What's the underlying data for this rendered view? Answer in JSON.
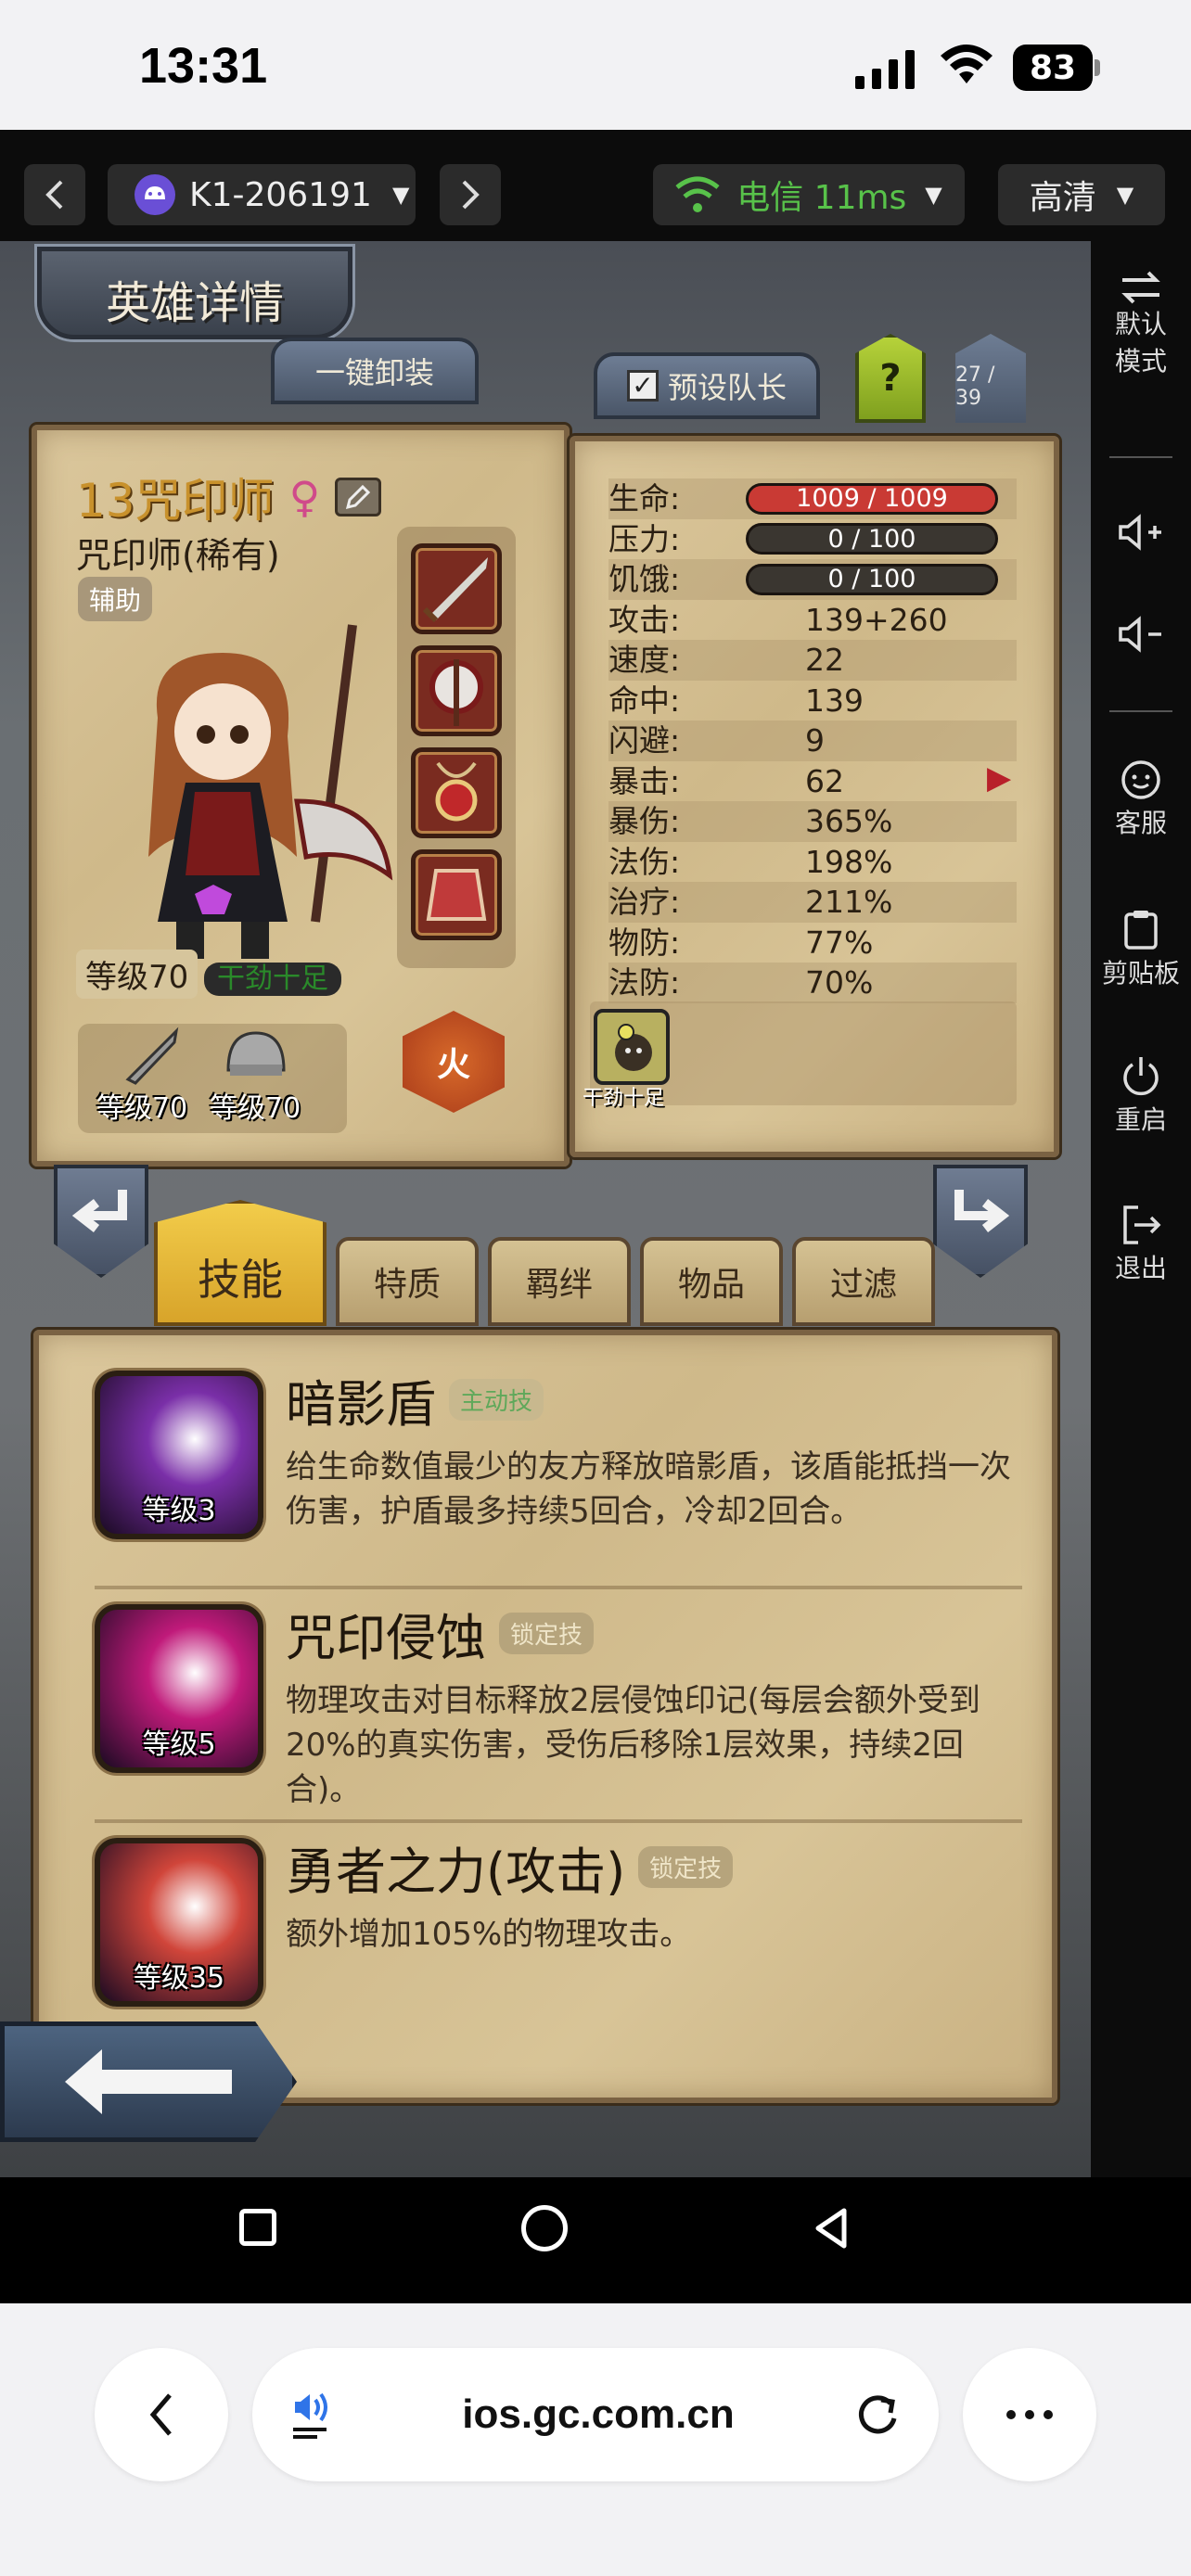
{
  "status_bar": {
    "time": "13:31",
    "battery": "83"
  },
  "toolbar": {
    "device_id": "K1-206191",
    "network": "电信 11ms",
    "quality": "高清"
  },
  "side_panel": [
    {
      "icon": "swap-icon",
      "label": "默认\n模式"
    },
    {
      "icon": "volume-up-icon",
      "label": ""
    },
    {
      "icon": "volume-down-icon",
      "label": ""
    },
    {
      "icon": "support-icon",
      "label": "客服"
    },
    {
      "icon": "clipboard-icon",
      "label": "剪贴板"
    },
    {
      "icon": "power-icon",
      "label": "重启"
    },
    {
      "icon": "exit-icon",
      "label": "退出"
    }
  ],
  "game": {
    "title": "英雄详情",
    "unequip_all": "一键卸装",
    "preset_leader": "预设队长",
    "help": "?",
    "page_counter": "27 / 39",
    "hero": {
      "name": "13咒印师",
      "class": "咒印师(稀有)",
      "role": "辅助",
      "level": "等级70",
      "mood": "干劲十足",
      "weapon_level": "等级70",
      "armor_level": "等级70",
      "element": "火"
    },
    "stats": [
      {
        "label": "生命:",
        "value": "1009 / 1009",
        "kind": "bar",
        "color": "#c93a34",
        "fill": 1.0
      },
      {
        "label": "压力:",
        "value": "0 / 100",
        "kind": "bar",
        "color": "#3a3630",
        "fill": 0
      },
      {
        "label": "饥饿:",
        "value": "0 / 100",
        "kind": "bar",
        "color": "#3a3630",
        "fill": 0
      },
      {
        "label": "攻击:",
        "value": "139+260"
      },
      {
        "label": "速度:",
        "value": "22"
      },
      {
        "label": "命中:",
        "value": "139"
      },
      {
        "label": "闪避:",
        "value": "9"
      },
      {
        "label": "暴击:",
        "value": "62"
      },
      {
        "label": "暴伤:",
        "value": "365%"
      },
      {
        "label": "法伤:",
        "value": "198%"
      },
      {
        "label": "治疗:",
        "value": "211%"
      },
      {
        "label": "物防:",
        "value": "77%"
      },
      {
        "label": "法防:",
        "value": "70%"
      }
    ],
    "trait_icon_label": "干劲十足",
    "tabs": [
      "技能",
      "特质",
      "羁绊",
      "物品",
      "过滤"
    ],
    "skills": [
      {
        "name": "暗影盾",
        "tag": "主动技",
        "tag_color": "#5fa85a",
        "level": "等级3",
        "desc": "给生命数值最少的友方释放暗影盾，该盾能抵挡一次伤害，护盾最多持续5回合，冷却2回合。",
        "icon_color": "#7a2fa8"
      },
      {
        "name": "咒印侵蚀",
        "tag": "锁定技",
        "tag_color": "#b6a47c",
        "level": "等级5",
        "desc": "物理攻击对目标释放2层侵蚀印记(每层会额外受到20%的真实伤害，受伤后移除1层效果，持续2回合)。",
        "icon_color": "#c01a7a"
      },
      {
        "name": "勇者之力(攻击)",
        "tag": "锁定技",
        "tag_color": "#b6a47c",
        "level": "等级35",
        "desc": "额外增加105%的物理攻击。",
        "icon_color": "#d0453a"
      }
    ]
  },
  "browser": {
    "url": "ios.gc.com.cn"
  }
}
